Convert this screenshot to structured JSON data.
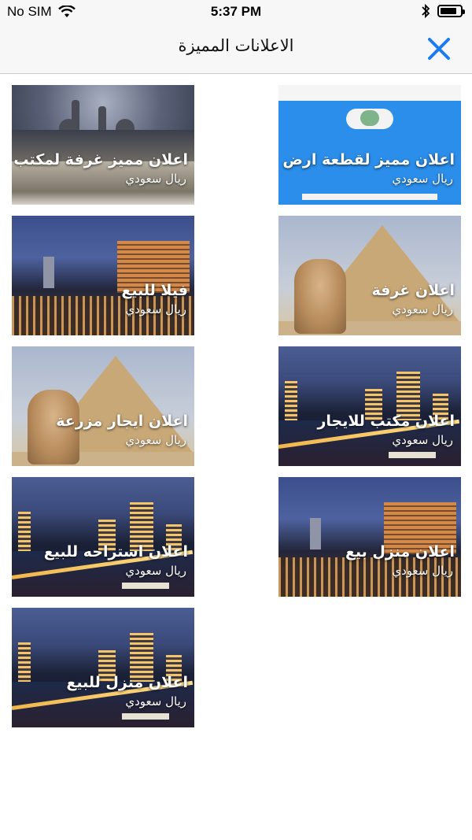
{
  "status_bar": {
    "carrier": "No SIM",
    "time": "5:37 PM",
    "battery_level": 0.85
  },
  "nav": {
    "title": "الاعلانات المميزة"
  },
  "cards": [
    {
      "title": "اعلان مميز لقطعة ارض",
      "price": "ريال سعودي"
    },
    {
      "title": "اعلان مميز غرفة لمكتب",
      "price": "ريال سعودي"
    },
    {
      "title": "اعلان غرفة",
      "price": "ريال سعودي"
    },
    {
      "title": "فيلا للبيع",
      "price": "ريال سعودي"
    },
    {
      "title": "اعلان مكتب للايجار",
      "price": "ريال سعودي"
    },
    {
      "title": "اعلان ايجار مزرعة",
      "price": "ريال سعودي"
    },
    {
      "title": "اعلان منزل بيع",
      "price": "ريال سعودي"
    },
    {
      "title": "اعلان استراحه للبيع",
      "price": "ريال سعودي"
    },
    {
      "title": "اعلان منزل للبيع",
      "price": "ريال سعودي"
    }
  ],
  "colors": {
    "accent": "#1a7cf0",
    "bar_bg": "#f7f7f7"
  }
}
